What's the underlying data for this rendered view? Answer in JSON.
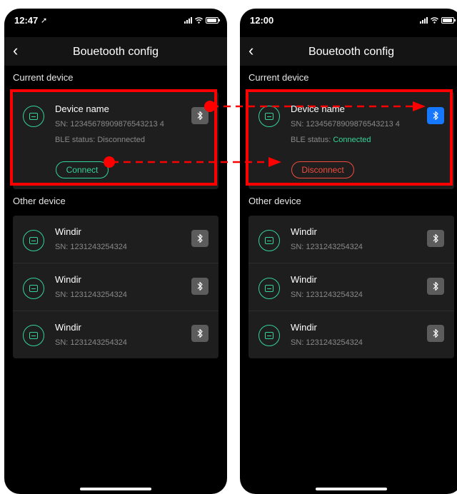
{
  "screens": [
    {
      "status_time": "12:47",
      "nav_title": "Bouetooth config",
      "current_section": "Current device",
      "current_device": {
        "name": "Device name",
        "sn": "SN: 12345678909876543213 4",
        "ble_label": "BLE status:",
        "ble_value": "Disconnected",
        "action": "Connect"
      },
      "other_section": "Other device",
      "others": [
        {
          "name": "Windir",
          "sn": "SN: 1231243254324"
        },
        {
          "name": "Windir",
          "sn": "SN: 1231243254324"
        },
        {
          "name": "Windir",
          "sn": "SN: 1231243254324"
        }
      ]
    },
    {
      "status_time": "12:00",
      "nav_title": "Bouetooth config",
      "current_section": "Current device",
      "current_device": {
        "name": "Device name",
        "sn": "SN: 12345678909876543213 4",
        "ble_label": "BLE status:",
        "ble_value": "Connected",
        "action": "Disconnect"
      },
      "other_section": "Other device",
      "others": [
        {
          "name": "Windir",
          "sn": "SN: 1231243254324"
        },
        {
          "name": "Windir",
          "sn": "SN: 1231243254324"
        },
        {
          "name": "Windir",
          "sn": "SN: 1231243254324"
        }
      ]
    }
  ],
  "colors": {
    "accent_green": "#34d399",
    "danger_red": "#f24b3d",
    "bt_blue": "#1677ff",
    "annotation_red": "#ff0000"
  },
  "icons": [
    "back-chevron-icon",
    "device-icon",
    "bluetooth-icon",
    "signal-icon",
    "wifi-icon",
    "battery-icon"
  ]
}
